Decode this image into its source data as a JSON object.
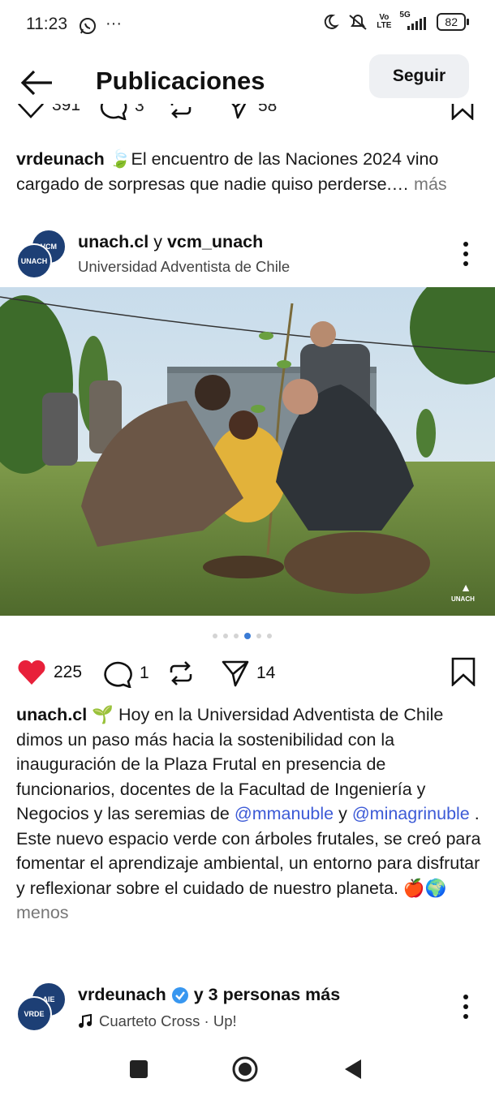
{
  "status": {
    "time": "11:23",
    "network_top": "5G",
    "volte_top": "Vo",
    "volte_bottom": "LTE",
    "battery": "82"
  },
  "header": {
    "title": "Publicaciones",
    "follow_label": "Seguir"
  },
  "prev_post": {
    "likes": "391",
    "comments": "3",
    "shares": "58",
    "caption_user": "vrdeunach",
    "caption_emoji": "🍃",
    "caption_text": "El encuentro de las Naciones 2024 vino cargado de sorpresas que nadie quiso perderse.…",
    "more_label": "más"
  },
  "post": {
    "avatar_top_text": "VCM",
    "avatar_bottom_text": "UNACH",
    "user1": "unach.cl",
    "joiner": "y",
    "user2": "vcm_unach",
    "subtitle": "Universidad Adventista de Chile",
    "watermark": "UNACH",
    "carousel_count": 6,
    "carousel_active": 4,
    "likes": "225",
    "comments": "1",
    "shares": "14",
    "caption_user": "unach.cl",
    "caption_emoji": "🌱",
    "caption_p1": "Hoy en la Universidad Adventista de Chile dimos un paso más hacia la sostenibilidad con la inauguración de la Plaza Frutal en presencia de funcionarios, docentes de la Facultad de Ingeniería y Negocios y las seremias de",
    "mention1": "@mmanuble",
    "caption_and": "y",
    "mention2": "@minagrinuble",
    "caption_dot": ".",
    "caption_p2": "Este nuevo espacio verde con árboles frutales, se creó para fomentar el aprendizaje ambiental, un entorno para disfrutar y reflexionar sobre el cuidado de nuestro planeta.",
    "caption_emojis_end": "🍎🌍",
    "less_label": "menos"
  },
  "next_post": {
    "avatar_top_text": "AIE",
    "avatar_bottom_text": "VRDE",
    "user": "vrdeunach",
    "others": "y 3 personas más",
    "music": "Cuarteto Cross · Up!"
  },
  "colors": {
    "heart": "#e8203a",
    "verified": "#3897f0",
    "mention": "#3c5ad6",
    "avatar": "#1d3f75"
  }
}
